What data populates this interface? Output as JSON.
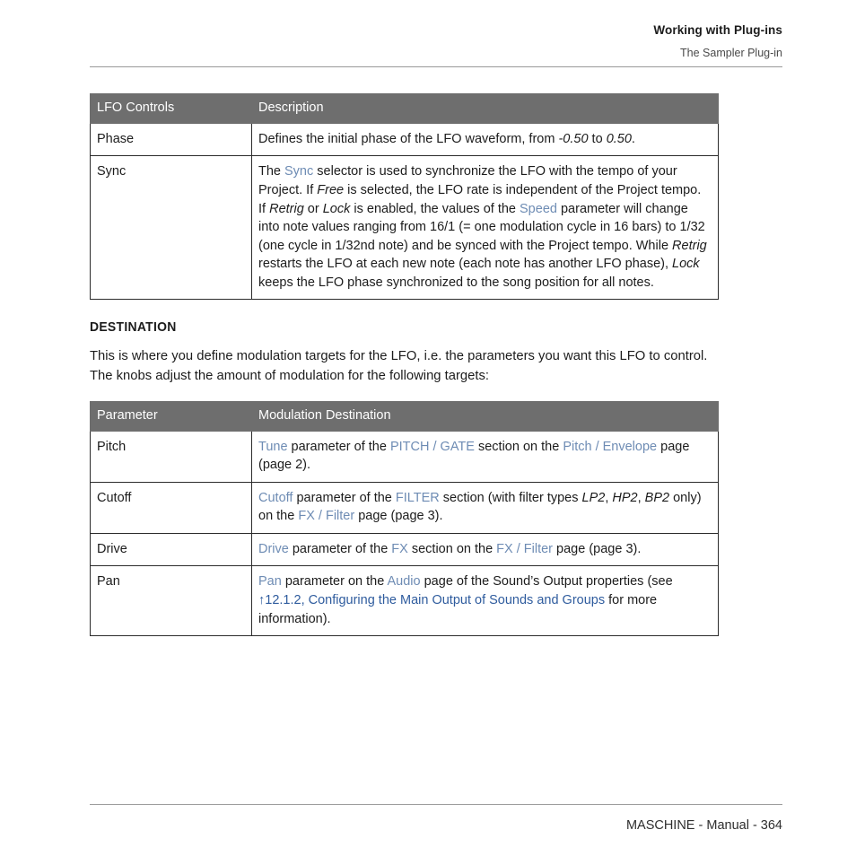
{
  "header": {
    "title": "Working with Plug-ins",
    "subtitle": "The Sampler Plug-in"
  },
  "footer": {
    "text": "MASCHINE - Manual - 364"
  },
  "colors": {
    "table_header_bg": "#6e6e6e",
    "table_header_text": "#ffffff",
    "link": "#6e8cb4",
    "cross_reference_link": "#2f5c9e",
    "body_text": "#1c1c1c",
    "rule": "#9a9a9a"
  },
  "lfo_table": {
    "headers": [
      "LFO Controls",
      "Description"
    ],
    "rows": [
      {
        "parameter": "Phase",
        "description_plain": "Defines the initial phase of the LFO waveform, from -0.50 to 0.50.",
        "description_parts": [
          {
            "t": "Defines the initial phase of the LFO waveform, from ",
            "s": "plain"
          },
          {
            "t": "-0.50",
            "s": "italic"
          },
          {
            "t": " to ",
            "s": "plain"
          },
          {
            "t": "0.50",
            "s": "italic"
          },
          {
            "t": ".",
            "s": "plain"
          }
        ]
      },
      {
        "parameter": "Sync",
        "description_plain": "The Sync selector is used to synchronize the LFO with the tempo of your Project. If Free is selected, the LFO rate is independent of the Project tempo. If Retrig or Lock is enabled, the values of the Speed parameter will change into note values ranging from 16/1 (= one modulation cycle in 16 bars) to 1/32 (one cycle in 1/32nd note) and be synced with the Project tempo. While Retrig restarts the LFO at each new note (each note has another LFO phase), Lock keeps the LFO phase synchronized to the song position for all notes.",
        "description_parts": [
          {
            "t": "The ",
            "s": "plain"
          },
          {
            "t": "Sync",
            "s": "link"
          },
          {
            "t": " selector is used to synchronize the LFO with the tempo of your Project. If ",
            "s": "plain"
          },
          {
            "t": "Free",
            "s": "italic"
          },
          {
            "t": " is selected, the LFO rate is independent of the Project tempo. If ",
            "s": "plain"
          },
          {
            "t": "Retrig",
            "s": "italic"
          },
          {
            "t": " or ",
            "s": "plain"
          },
          {
            "t": "Lock",
            "s": "italic"
          },
          {
            "t": " is enabled, the values of the ",
            "s": "plain"
          },
          {
            "t": "Speed",
            "s": "link"
          },
          {
            "t": " parameter will change into note values ranging from 16/1 (= one modulation cycle in 16 bars) to 1/32 (one cycle in 1/32nd note) and be synced with the Project tempo. While ",
            "s": "plain"
          },
          {
            "t": "Retrig",
            "s": "italic"
          },
          {
            "t": " restarts the LFO at each new note (each note has another LFO phase), ",
            "s": "plain"
          },
          {
            "t": "Lock",
            "s": "italic"
          },
          {
            "t": " keeps the LFO phase synchronized to the song position for all notes.",
            "s": "plain"
          }
        ]
      }
    ]
  },
  "destination_section": {
    "heading": "DESTINATION",
    "intro": "This is where you define modulation targets for the LFO, i.e. the parameters you want this LFO to control. The knobs adjust the amount of modulation for the following targets:"
  },
  "destination_table": {
    "headers": [
      "Parameter",
      "Modulation Destination"
    ],
    "rows": [
      {
        "parameter": "Pitch",
        "description_plain": "Tune parameter of the PITCH / GATE section on the Pitch / Envelope page (page 2).",
        "description_parts": [
          {
            "t": "Tune",
            "s": "link"
          },
          {
            "t": " parameter of the ",
            "s": "plain"
          },
          {
            "t": "PITCH / GATE",
            "s": "link"
          },
          {
            "t": " section on the ",
            "s": "plain"
          },
          {
            "t": "Pitch / Envelope",
            "s": "link"
          },
          {
            "t": " page (page 2).",
            "s": "plain"
          }
        ]
      },
      {
        "parameter": "Cutoff",
        "description_plain": "Cutoff parameter of the FILTER section (with filter types LP2, HP2, BP2 only) on the FX / Filter page (page 3).",
        "description_parts": [
          {
            "t": "Cutoff",
            "s": "link"
          },
          {
            "t": " parameter of the ",
            "s": "plain"
          },
          {
            "t": "FILTER",
            "s": "link"
          },
          {
            "t": " section (with filter types ",
            "s": "plain"
          },
          {
            "t": "LP2",
            "s": "italic"
          },
          {
            "t": ", ",
            "s": "plain"
          },
          {
            "t": "HP2",
            "s": "italic"
          },
          {
            "t": ", ",
            "s": "plain"
          },
          {
            "t": "BP2",
            "s": "italic"
          },
          {
            "t": " only) on the ",
            "s": "plain"
          },
          {
            "t": "FX / Filter",
            "s": "link"
          },
          {
            "t": " page (page 3).",
            "s": "plain"
          }
        ]
      },
      {
        "parameter": "Drive",
        "description_plain": "Drive parameter of the FX section on the FX / Filter page (page 3).",
        "description_parts": [
          {
            "t": "Drive",
            "s": "link"
          },
          {
            "t": " parameter of the ",
            "s": "plain"
          },
          {
            "t": "FX",
            "s": "link"
          },
          {
            "t": " section on the ",
            "s": "plain"
          },
          {
            "t": "FX / Filter",
            "s": "link"
          },
          {
            "t": " page (page 3).",
            "s": "plain"
          }
        ]
      },
      {
        "parameter": "Pan",
        "description_plain": "Pan parameter on the Audio page of the Sound’s Output properties (see ↑12.1.2, Configuring the Main Output of Sounds and Groups for more information).",
        "description_parts": [
          {
            "t": "Pan",
            "s": "link"
          },
          {
            "t": " parameter on the ",
            "s": "plain"
          },
          {
            "t": "Audio",
            "s": "link"
          },
          {
            "t": " page of the Sound’s Output properties (see ",
            "s": "plain"
          },
          {
            "t": "↑12.1.2, Configuring the Main Output of Sounds and Groups",
            "s": "xref"
          },
          {
            "t": " for more information).",
            "s": "plain"
          }
        ]
      }
    ]
  }
}
